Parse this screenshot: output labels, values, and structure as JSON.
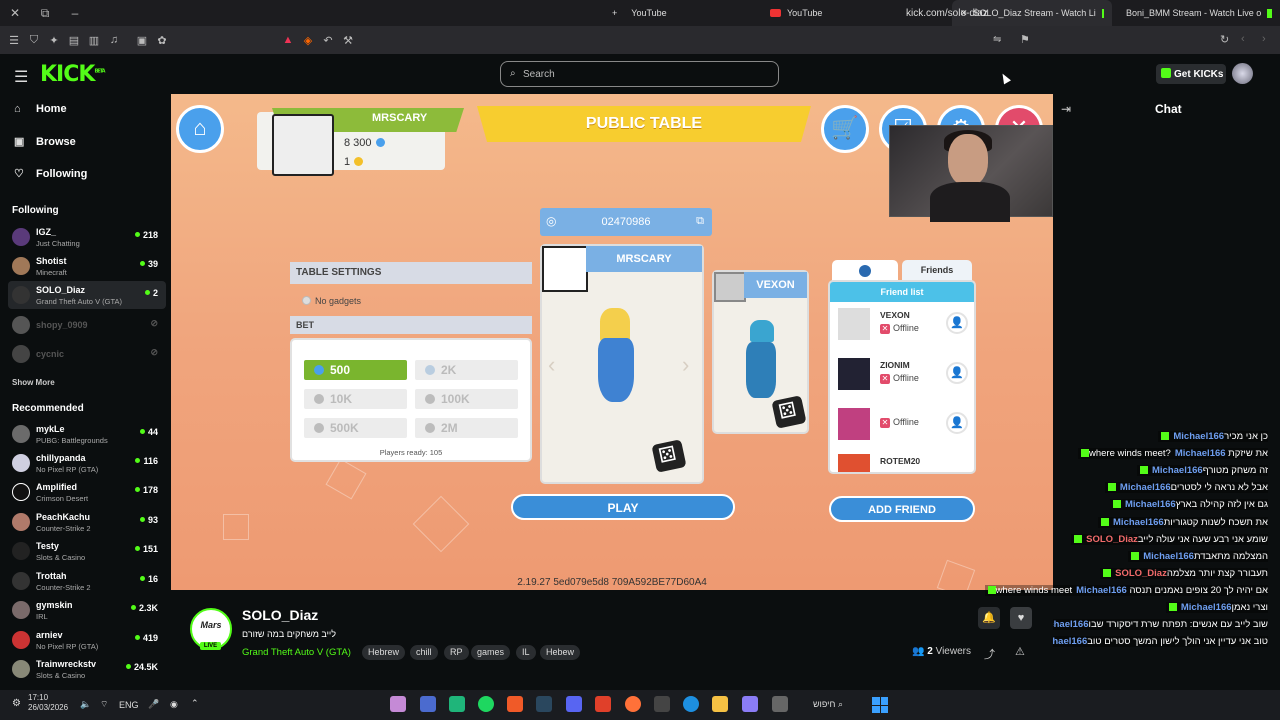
{
  "browser": {
    "tabs": [
      {
        "label": "YouTube",
        "active": false
      },
      {
        "label": "YouTube",
        "active": false
      },
      {
        "label": "SOLO_Diaz Stream - Watch Li",
        "active": true
      },
      {
        "label": "Boni_BMM Stream - Watch Live o",
        "active": false
      }
    ],
    "url": "kick.com/solo-diaz"
  },
  "site": {
    "logo": "KICK",
    "logo_sup": "BETA",
    "search_placeholder": "Search",
    "get_kicks": "Get KICKs",
    "brand_color": "#53fc18"
  },
  "sidebar": {
    "nav": [
      {
        "label": "Home",
        "icon": "home-icon"
      },
      {
        "label": "Browse",
        "icon": "browse-icon"
      },
      {
        "label": "Following",
        "icon": "heart-icon"
      }
    ],
    "following_title": "Following",
    "following": [
      {
        "name": "IGZ_",
        "category": "Just Chatting",
        "viewers": "218",
        "live": true
      },
      {
        "name": "Shotist",
        "category": "Minecraft",
        "viewers": "39",
        "live": true
      },
      {
        "name": "SOLO_Diaz",
        "category": "Grand Theft Auto V (GTA)",
        "viewers": "2",
        "live": true,
        "selected": true
      },
      {
        "name": "shopy_0909",
        "category": "",
        "viewers": "",
        "live": false
      },
      {
        "name": "cycnic",
        "category": "",
        "viewers": "",
        "live": false
      }
    ],
    "show_more": "Show More",
    "recommended_title": "Recommended",
    "recommended": [
      {
        "name": "mykLe",
        "category": "PUBG: Battlegrounds",
        "viewers": "44"
      },
      {
        "name": "chillypanda",
        "category": "No Pixel RP (GTA)",
        "viewers": "116"
      },
      {
        "name": "Amplified",
        "category": "Crimson Desert",
        "viewers": "178"
      },
      {
        "name": "PeachKachu",
        "category": "Counter-Strike 2",
        "viewers": "93"
      },
      {
        "name": "Testy",
        "category": "Slots & Casino",
        "viewers": "151"
      },
      {
        "name": "Trottah",
        "category": "Counter-Strike 2",
        "viewers": "16"
      },
      {
        "name": "gymskin",
        "category": "IRL",
        "viewers": "2.3K"
      },
      {
        "name": "arniev",
        "category": "No Pixel RP (GTA)",
        "viewers": "419"
      },
      {
        "name": "Trainwreckstv",
        "category": "Slots & Casino",
        "viewers": "24.5K"
      }
    ]
  },
  "game": {
    "player_name": "MRSCARY",
    "balance": "8 300",
    "gold": "1",
    "title": "PUBLIC TABLE",
    "table_code": "02470986",
    "table_settings": "TABLE SETTINGS",
    "no_gadgets": "No gadgets",
    "bet_title": "BET",
    "bets": [
      "500",
      "2K",
      "10K",
      "100K",
      "500K",
      "2M"
    ],
    "selected_bet": "500",
    "players_ready": "Players ready: 105",
    "player1": "MRSCARY",
    "player2": "VEXON",
    "play": "PLAY",
    "friends_tab": "Friends",
    "friend_list": "Friend list",
    "friends": [
      {
        "name": "VEXON",
        "status": "Offline"
      },
      {
        "name": "ZIONIM",
        "status": "Offline"
      },
      {
        "name": "",
        "status": "Offline"
      },
      {
        "name": "ROTEM20",
        "status": ""
      }
    ],
    "add_friend": "ADD FRIEND",
    "version": "2.19.27 5ed079e5d8 709A592BE77D60A4"
  },
  "chat": {
    "title": "Chat",
    "messages": [
      {
        "user": "Michael166",
        "text": "כן אני מכיר",
        "color": "blue"
      },
      {
        "user": "Michael166",
        "text": "את שיזקת where winds meet?",
        "color": "blue"
      },
      {
        "user": "Michael166",
        "text": "זה משחק מטורף",
        "color": "blue"
      },
      {
        "user": "Michael166",
        "text": "אבל לא נראה לי לסטרים",
        "color": "blue"
      },
      {
        "user": "Michael166",
        "text": "גם אין לזה קהילה בארץ",
        "color": "blue"
      },
      {
        "user": "Michael166",
        "text": "את תשכח לשנות קטגוריות",
        "color": "blue"
      },
      {
        "user": "SOLO_Diaz",
        "text": "שומע אני רבע שעה אני עולה לייב",
        "color": "red"
      },
      {
        "user": "Michael166",
        "text": "המצלמה מתאבדת",
        "color": "blue"
      },
      {
        "user": "SOLO_Diaz",
        "text": "תעבורר קצת יותר מצלמה",
        "color": "red"
      },
      {
        "user": "Michael166",
        "text": "אם יהיה לך 20 צופים נאמנים תנסה where winds meet",
        "color": "blue"
      },
      {
        "user": "Michael166",
        "text": "וצרי נאמן",
        "color": "blue"
      },
      {
        "user": "Michael166",
        "text": "שוב לייב עם אנשים: תפתח שרת דיסקורד שבו",
        "color": "blue"
      },
      {
        "user": "Michael166",
        "text": "טוב אני עדיין אני הולך לישון המשך סטרים טוב",
        "color": "blue"
      }
    ]
  },
  "stream": {
    "logo_text": "Mars",
    "live": "LIVE",
    "name": "SOLO_Diaz",
    "title": "לייב משחקים במה שזורם",
    "category": "Grand Theft Auto V (GTA)",
    "tags": [
      "Hebrew",
      "chill",
      "RP",
      "games",
      "IL",
      "Hebew"
    ],
    "viewers": "2",
    "viewers_label": "Viewers"
  },
  "taskbar": {
    "time": "17:10",
    "date": "26/03/2026",
    "lang": "ENG",
    "search": "חיפוש"
  }
}
